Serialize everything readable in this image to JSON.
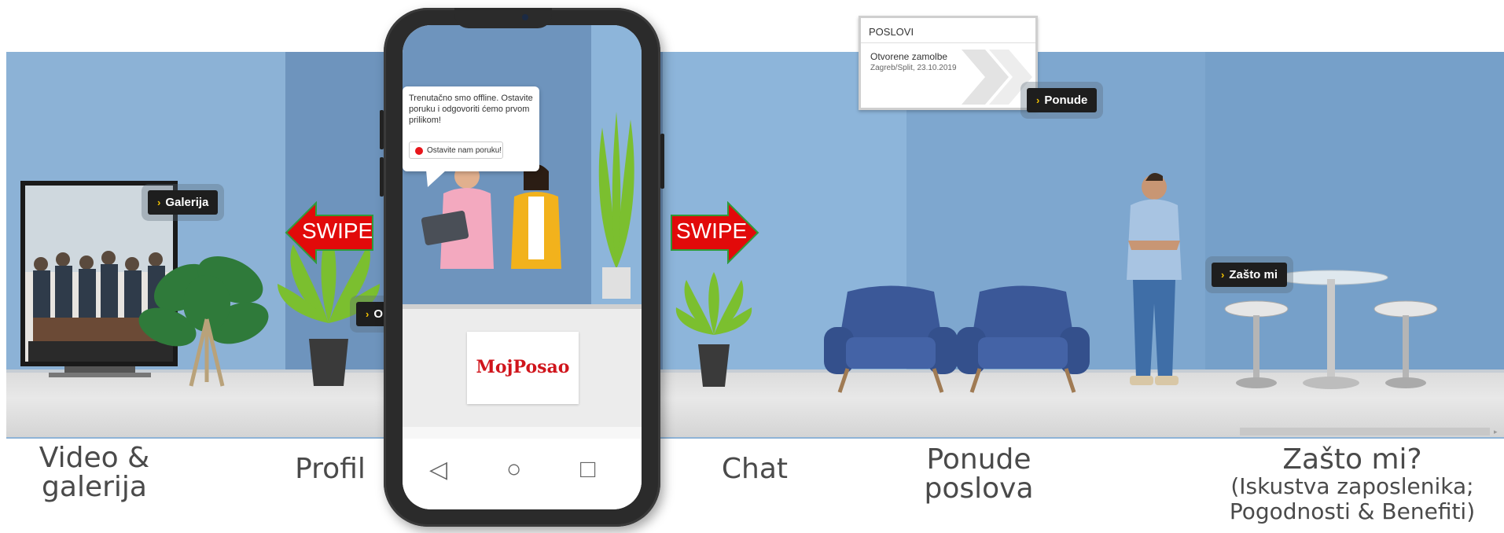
{
  "hotspots": {
    "galerija": "Galerija",
    "onama": "O nama",
    "ponude": "Ponude",
    "zasto_mi": "Zašto mi"
  },
  "swipe": {
    "left": "SWIPE",
    "right": "SWIPE"
  },
  "phone": {
    "chat_message": "Trenutačno smo offline. Ostavite poruku i odgovoriti ćemo prvom prilikom!",
    "leave_message_button": "Ostavite nam poruku!",
    "logo": "MojPosao",
    "nav": {
      "back": "◁",
      "home": "○",
      "recent": "□"
    }
  },
  "poslovi_board": {
    "title": "POSLOVI",
    "line1": "Otvorene zamolbe",
    "line2": "Zagreb/Split, 23.10.2019"
  },
  "labels": {
    "video_galerija_1": "Video &",
    "video_galerija_2": "galerija",
    "profil": "Profil",
    "chat": "Chat",
    "ponude_1": "Ponude",
    "ponude_2": "poslova",
    "zasto_1": "Zašto mi?",
    "zasto_2": "(Iskustva zaposlenika;",
    "zasto_3": "Pogodnosti & Benefiti)"
  },
  "colors": {
    "wall_light": "#8eb3d6",
    "wall_dark": "#6f96bf",
    "swipe_red": "#e20a0a",
    "button_bg": "#1e1e1e",
    "button_chevron": "#f5c400",
    "logo_red": "#d0151c"
  }
}
